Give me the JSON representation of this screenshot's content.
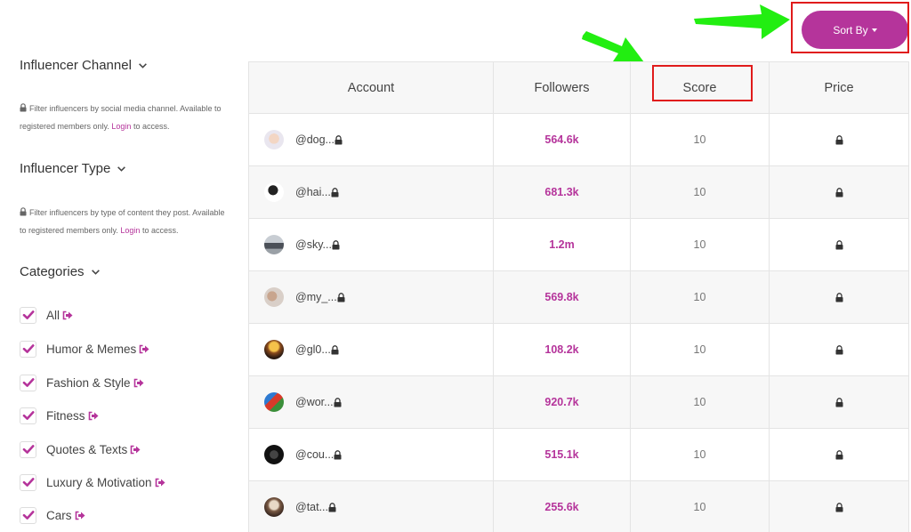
{
  "sidebar": {
    "channel": {
      "title": "Influencer Channel",
      "note_text": "Filter influencers by social media channel. Available to registered members only.",
      "login_link": "Login",
      "note_suffix": "to access."
    },
    "type": {
      "title": "Influencer Type",
      "note_text": "Filter influencers by type of content they post. Available to registered members only.",
      "login_link": "Login",
      "note_suffix": "to access."
    },
    "categories": {
      "title": "Categories",
      "items": [
        {
          "label": "All",
          "checked": true
        },
        {
          "label": "Humor & Memes",
          "checked": true
        },
        {
          "label": "Fashion & Style",
          "checked": true
        },
        {
          "label": "Fitness",
          "checked": true
        },
        {
          "label": "Quotes & Texts",
          "checked": true
        },
        {
          "label": "Luxury & Motivation",
          "checked": true
        },
        {
          "label": "Cars",
          "checked": true
        }
      ]
    }
  },
  "toolbar": {
    "sort_label": "Sort By"
  },
  "table": {
    "headers": {
      "account": "Account",
      "followers": "Followers",
      "score": "Score",
      "price": "Price"
    },
    "rows": [
      {
        "account": "@dog...",
        "followers": "564.6k",
        "score": "10"
      },
      {
        "account": "@hai...",
        "followers": "681.3k",
        "score": "10"
      },
      {
        "account": "@sky...",
        "followers": "1.2m",
        "score": "10"
      },
      {
        "account": "@my_...",
        "followers": "569.8k",
        "score": "10"
      },
      {
        "account": "@gl0...",
        "followers": "108.2k",
        "score": "10"
      },
      {
        "account": "@wor...",
        "followers": "920.7k",
        "score": "10"
      },
      {
        "account": "@cou...",
        "followers": "515.1k",
        "score": "10"
      },
      {
        "account": "@tat...",
        "followers": "255.6k",
        "score": "10"
      }
    ]
  },
  "colors": {
    "accent": "#b5349b",
    "highlight_box": "#e01b1b",
    "arrow": "#22ee11"
  }
}
